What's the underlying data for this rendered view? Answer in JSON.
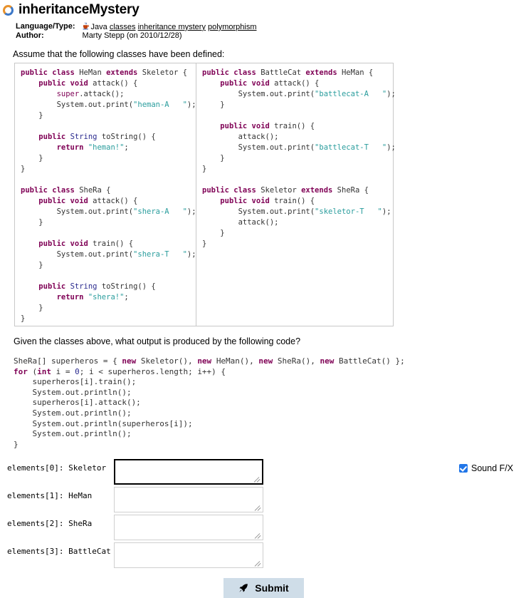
{
  "header": {
    "title": "inheritanceMystery",
    "spinner_icon": "loading-circle-icon",
    "meta": {
      "language_label": "Language/Type:",
      "java_icon": "java-coffee-cup-icon",
      "language_value": "Java",
      "tags": [
        "classes",
        "inheritance mystery",
        "polymorphism"
      ],
      "author_label": "Author:",
      "author_value": "Marty Stepp (on 2010/12/28)"
    },
    "assume_text": "Assume that the following classes have been defined:"
  },
  "code_panel": {
    "left_column": [
      {
        "t": "kw",
        "v": "public class "
      },
      {
        "t": "pln",
        "v": "HeMan "
      },
      {
        "t": "kw",
        "v": "extends "
      },
      {
        "t": "pln",
        "v": "Skeletor {\n    "
      },
      {
        "t": "kw",
        "v": "public void "
      },
      {
        "t": "pln",
        "v": "attack() {\n        "
      },
      {
        "t": "kw2",
        "v": "super"
      },
      {
        "t": "pln",
        "v": ".attack();\n        System.out.print("
      },
      {
        "t": "str",
        "v": "\"heman-A   \""
      },
      {
        "t": "pln",
        "v": ");\n    }\n\n    "
      },
      {
        "t": "kw",
        "v": "public "
      },
      {
        "t": "typ",
        "v": "String "
      },
      {
        "t": "pln",
        "v": "toString() {\n        "
      },
      {
        "t": "kw",
        "v": "return "
      },
      {
        "t": "str",
        "v": "\"heman!\""
      },
      {
        "t": "pln",
        "v": ";\n    }\n}\n\n"
      },
      {
        "t": "kw",
        "v": "public class "
      },
      {
        "t": "pln",
        "v": "SheRa {\n    "
      },
      {
        "t": "kw",
        "v": "public void "
      },
      {
        "t": "pln",
        "v": "attack() {\n        System.out.print("
      },
      {
        "t": "str",
        "v": "\"shera-A   \""
      },
      {
        "t": "pln",
        "v": ");\n    }\n\n    "
      },
      {
        "t": "kw",
        "v": "public void "
      },
      {
        "t": "pln",
        "v": "train() {\n        System.out.print("
      },
      {
        "t": "str",
        "v": "\"shera-T   \""
      },
      {
        "t": "pln",
        "v": ");\n    }\n\n    "
      },
      {
        "t": "kw",
        "v": "public "
      },
      {
        "t": "typ",
        "v": "String "
      },
      {
        "t": "pln",
        "v": "toString() {\n        "
      },
      {
        "t": "kw",
        "v": "return "
      },
      {
        "t": "str",
        "v": "\"shera!\""
      },
      {
        "t": "pln",
        "v": ";\n    }\n}"
      }
    ],
    "right_column": [
      {
        "t": "kw",
        "v": "public class "
      },
      {
        "t": "pln",
        "v": "BattleCat "
      },
      {
        "t": "kw",
        "v": "extends "
      },
      {
        "t": "pln",
        "v": "HeMan {\n    "
      },
      {
        "t": "kw",
        "v": "public void "
      },
      {
        "t": "pln",
        "v": "attack() {\n        System.out.print("
      },
      {
        "t": "str",
        "v": "\"battlecat-A   \""
      },
      {
        "t": "pln",
        "v": ");\n    }\n\n    "
      },
      {
        "t": "kw",
        "v": "public void "
      },
      {
        "t": "pln",
        "v": "train() {\n        attack();\n        System.out.print("
      },
      {
        "t": "str",
        "v": "\"battlecat-T   \""
      },
      {
        "t": "pln",
        "v": ");\n    }\n}\n\n"
      },
      {
        "t": "kw",
        "v": "public class "
      },
      {
        "t": "pln",
        "v": "Skeletor "
      },
      {
        "t": "kw",
        "v": "extends "
      },
      {
        "t": "pln",
        "v": "SheRa {\n    "
      },
      {
        "t": "kw",
        "v": "public void "
      },
      {
        "t": "pln",
        "v": "train() {\n        System.out.print("
      },
      {
        "t": "str",
        "v": "\"skeletor-T   \""
      },
      {
        "t": "pln",
        "v": ");\n        attack();\n    }\n}"
      }
    ]
  },
  "question": {
    "prompt": "Given the classes above, what output is produced by the following code?",
    "code": [
      {
        "t": "pln",
        "v": "SheRa[] superheros = { "
      },
      {
        "t": "kw",
        "v": "new "
      },
      {
        "t": "pln",
        "v": "Skeletor(), "
      },
      {
        "t": "kw",
        "v": "new "
      },
      {
        "t": "pln",
        "v": "HeMan(), "
      },
      {
        "t": "kw",
        "v": "new "
      },
      {
        "t": "pln",
        "v": "SheRa(), "
      },
      {
        "t": "kw",
        "v": "new "
      },
      {
        "t": "pln",
        "v": "BattleCat() };\n"
      },
      {
        "t": "kw",
        "v": "for "
      },
      {
        "t": "pln",
        "v": "("
      },
      {
        "t": "kw",
        "v": "int "
      },
      {
        "t": "pln",
        "v": "i = "
      },
      {
        "t": "typ",
        "v": "0"
      },
      {
        "t": "pln",
        "v": "; i < superheros.length; i++) {\n    superheros[i].train();\n    System.out.println();\n    superheros[i].attack();\n    System.out.println();\n    System.out.println(superheros[i]);\n    System.out.println();\n}"
      }
    ]
  },
  "answers": {
    "rows": [
      {
        "label": "elements[0]: Skeletor",
        "value": "",
        "focused": true
      },
      {
        "label": "elements[1]: HeMan",
        "value": "",
        "focused": false
      },
      {
        "label": "elements[2]: SheRa",
        "value": "",
        "focused": false
      },
      {
        "label": "elements[3]: BattleCat",
        "value": "",
        "focused": false
      }
    ]
  },
  "sound_fx": {
    "label": "Sound F/X",
    "checked": true,
    "accent_color": "#2176e8"
  },
  "submit": {
    "label": "Submit",
    "icon": "rocket-icon",
    "background_color": "#cfdde8"
  }
}
